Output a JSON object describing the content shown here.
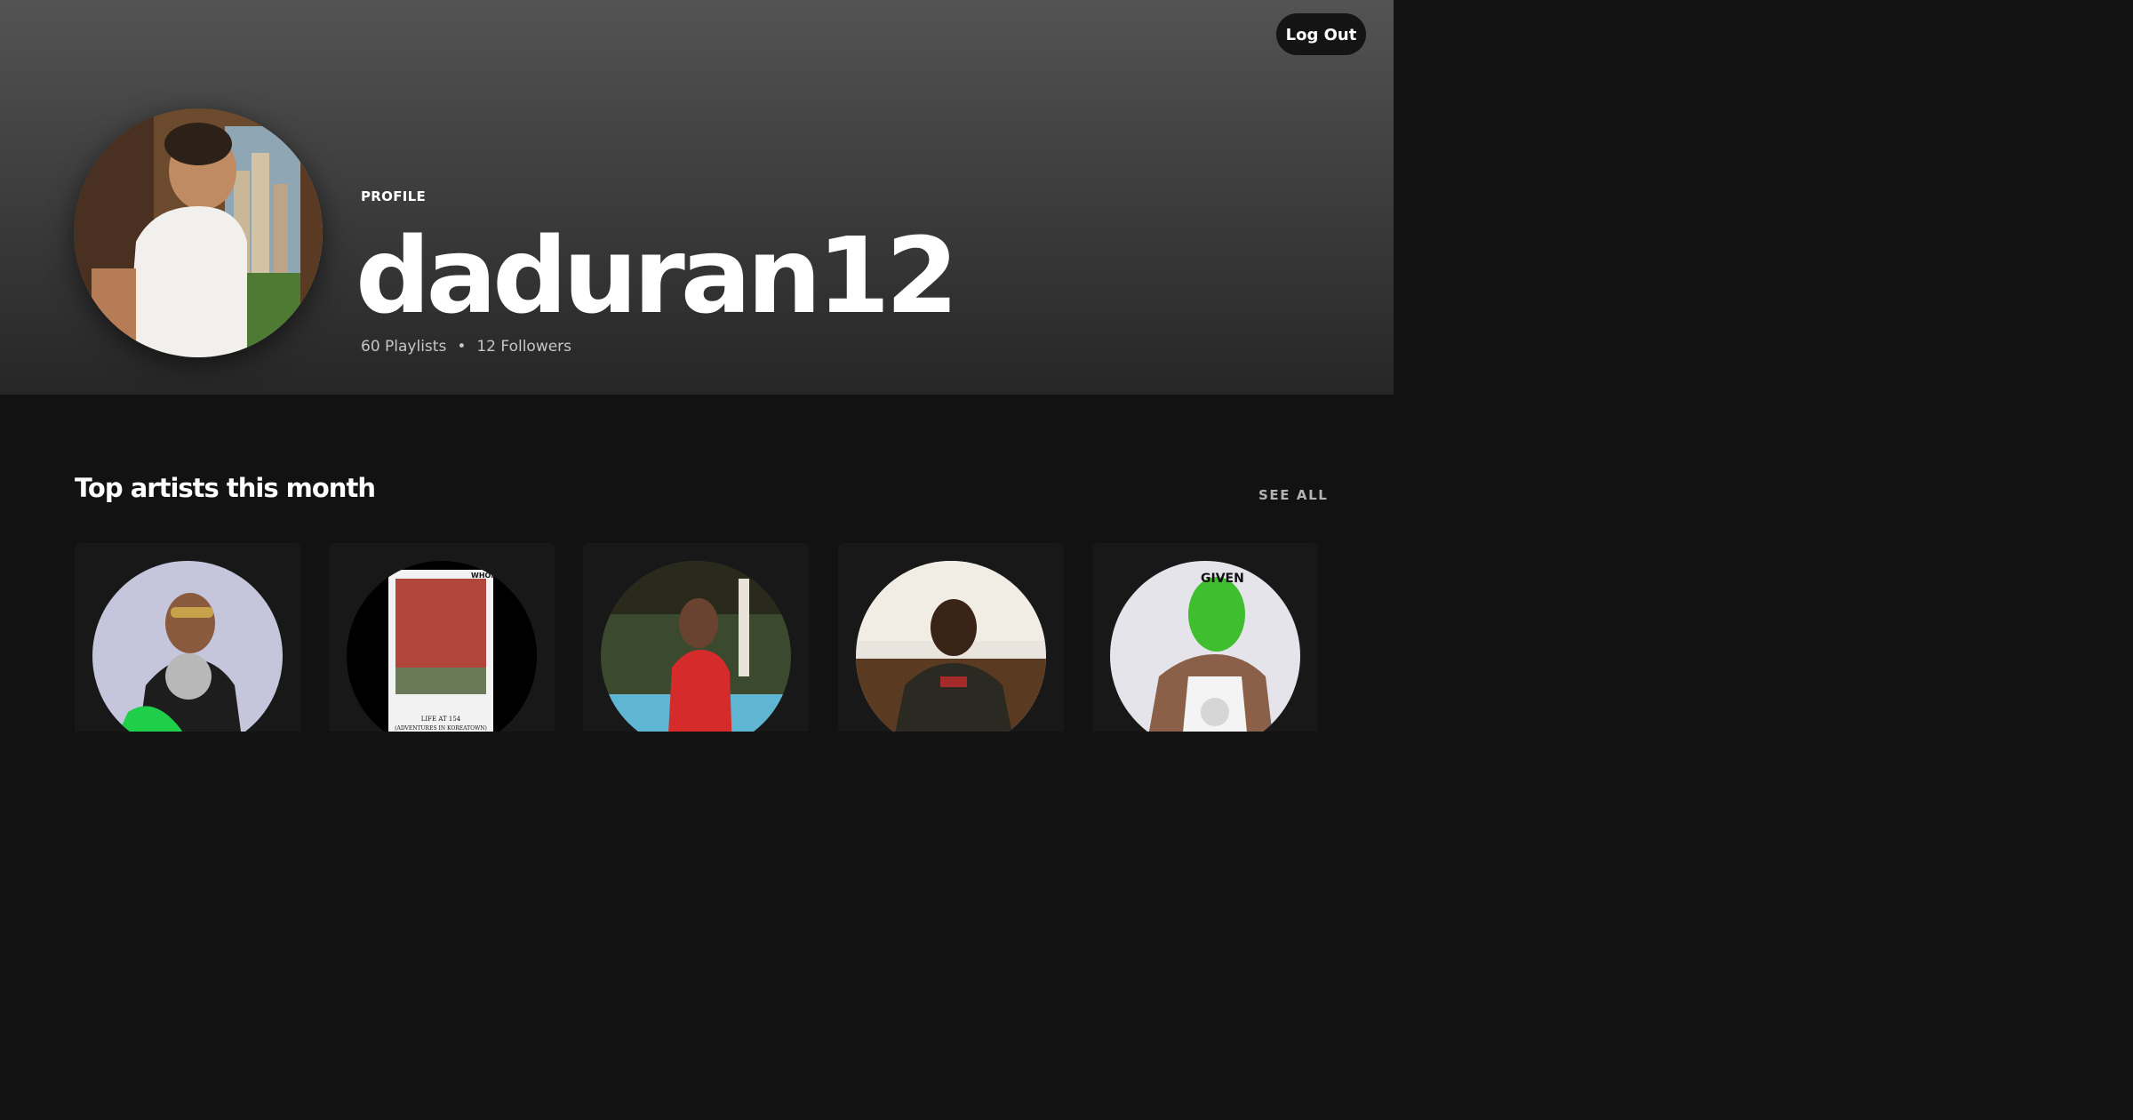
{
  "header": {
    "logout_label": "Log Out"
  },
  "profile": {
    "type_label": "PROFILE",
    "username": "daduran12",
    "playlists": "60 Playlists",
    "separator": "•",
    "followers": "12 Followers"
  },
  "top_artists": {
    "title": "Top artists this month",
    "see_all_label": "SEE ALL",
    "items": [
      {
        "bg": "#c5c6dc",
        "accent": "#1fcf4a"
      },
      {
        "bg": "#000000",
        "accent": "#b3463c",
        "cover_top": "WHOME",
        "cover_line1": "LIFE AT 154",
        "cover_line2": "(ADVENTURES IN KOREATOWN)"
      },
      {
        "bg": "#3b4a2e",
        "accent": "#d52b2b"
      },
      {
        "bg": "#e9e4dd",
        "accent": "#2a2a22"
      },
      {
        "bg": "#e4e4ea",
        "accent": "#3fbf2f",
        "mask_text": "GIVEN"
      }
    ]
  }
}
